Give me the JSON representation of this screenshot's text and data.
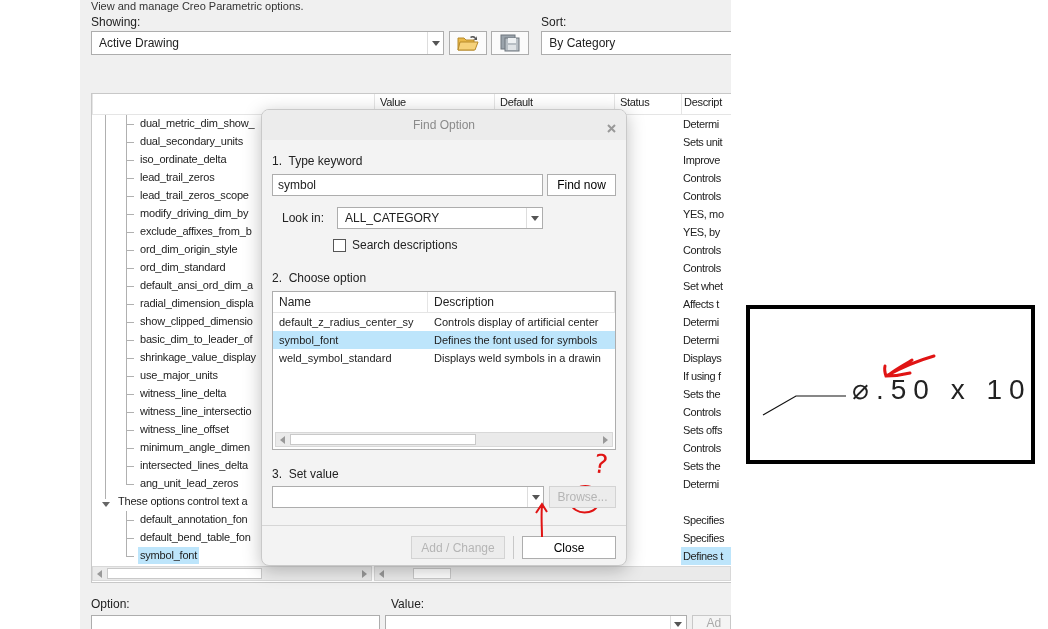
{
  "intro": "View and manage Creo Parametric options.",
  "showing": {
    "label": "Showing:",
    "value": "Active Drawing"
  },
  "toolbar_buttons": [
    {
      "kind": "open"
    },
    {
      "kind": "save"
    }
  ],
  "sort": {
    "label": "Sort:",
    "value": "By Category"
  },
  "options_table": {
    "columns": [
      "Value",
      "Default",
      "Status",
      "Descript"
    ],
    "tree": [
      {
        "children": [
          {
            "name": "dual_metric_dim_show_",
            "description": "Determi",
            "selected": false
          },
          {
            "name": "dual_secondary_units",
            "description": "Sets unit",
            "selected": false
          },
          {
            "name": "iso_ordinate_delta",
            "description": "Improve",
            "selected": false
          },
          {
            "name": "lead_trail_zeros",
            "description": "Controls",
            "selected": false
          },
          {
            "name": "lead_trail_zeros_scope",
            "description": "Controls",
            "selected": false
          },
          {
            "name": "modify_driving_dim_by",
            "description": "YES, mo",
            "selected": false
          },
          {
            "name": "exclude_affixes_from_b",
            "description": "YES, by",
            "selected": false
          },
          {
            "name": "ord_dim_origin_style",
            "description": "Controls",
            "selected": false
          },
          {
            "name": "ord_dim_standard",
            "description": "Controls",
            "selected": false
          },
          {
            "name": "default_ansi_ord_dim_a",
            "description": "Set whet",
            "selected": false
          },
          {
            "name": "radial_dimension_displa",
            "description": "Affects t",
            "selected": false
          },
          {
            "name": "show_clipped_dimensio",
            "description": "Determi",
            "selected": false
          },
          {
            "name": "basic_dim_to_leader_of",
            "description": "Determi",
            "selected": false
          },
          {
            "name": "shrinkage_value_display",
            "description": "Displays",
            "selected": false
          },
          {
            "name": "use_major_units",
            "description": "If using f",
            "selected": false
          },
          {
            "name": "witness_line_delta",
            "description": "Sets the",
            "selected": false
          },
          {
            "name": "witness_line_intersectio",
            "description": "Controls",
            "selected": false
          },
          {
            "name": "witness_line_offset",
            "description": "Sets offs",
            "selected": false
          },
          {
            "name": "minimum_angle_dimen",
            "description": "Controls",
            "selected": false
          },
          {
            "name": "intersected_lines_delta",
            "description": "Sets the",
            "selected": false
          },
          {
            "name": "ang_unit_lead_zeros",
            "description": "Determi",
            "selected": false
          }
        ]
      },
      {
        "label": "These options control text a",
        "expanded": true,
        "children": [
          {
            "name": "default_annotation_fon",
            "description": "Specifies",
            "selected": false
          },
          {
            "name": "default_bend_table_fon",
            "description": "Specifies",
            "selected": false
          },
          {
            "name": "symbol_font",
            "description": "Defines t",
            "selected": true
          }
        ]
      }
    ]
  },
  "bottom": {
    "option_label": "Option:",
    "value_label": "Value:",
    "add_button": "Ad"
  },
  "find_dialog": {
    "title": "Find Option",
    "step1": "1.  Type keyword",
    "keyword": "symbol",
    "find_button": "Find now",
    "look_in_label": "Look in:",
    "look_in": "ALL_CATEGORY",
    "search_descriptions": {
      "label": "Search descriptions",
      "checked": false
    },
    "step2": "2.  Choose option",
    "results": {
      "columns": [
        "Name",
        "Description"
      ],
      "rows": [
        {
          "name": "default_z_radius_center_sy",
          "description": "Controls display of artificial center",
          "selected": false
        },
        {
          "name": "symbol_font",
          "description": "Defines the font used for symbols",
          "selected": true
        },
        {
          "name": "weld_symbol_standard",
          "description": "Displays weld symbols in a drawin",
          "selected": false
        }
      ]
    },
    "step3": "3.  Set value",
    "browse_button": {
      "label": "Browse...",
      "disabled": true
    },
    "add_change_button": {
      "label": "Add / Change",
      "disabled": true
    },
    "close_button": "Close"
  },
  "annotations": {
    "question_mark": "?"
  },
  "callout": {
    "dimension_text": "⌀.50 x 10"
  }
}
